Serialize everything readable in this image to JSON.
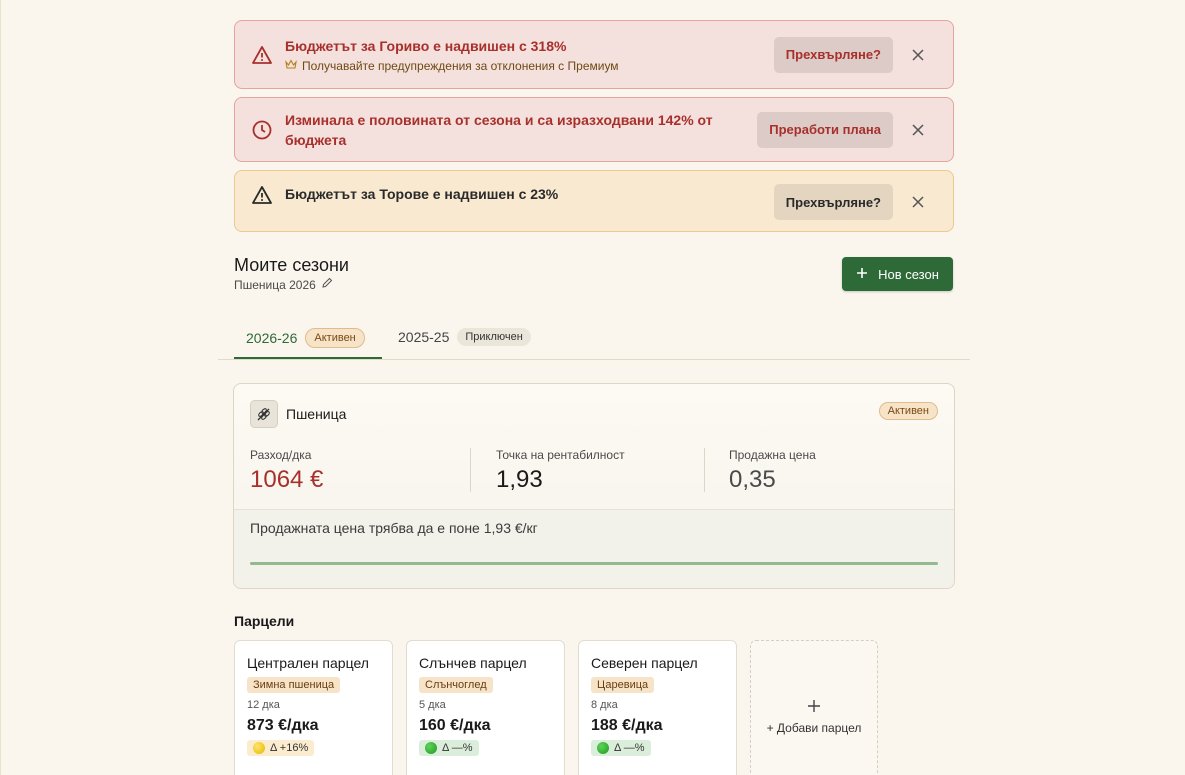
{
  "alerts": [
    {
      "title": "Бюджетът за Гориво е надвишен с 318%",
      "sub": "Получавайте предупреждения за отклонения с Премиум",
      "button": "Прехвърляне?"
    },
    {
      "title": "Изминала е половината от сезона и са изразходвани 142% от бюджета",
      "button": "Преработи плана"
    },
    {
      "title": "Бюджетът за Торове е надвишен с 23%",
      "button": "Прехвърляне?"
    }
  ],
  "seasons": {
    "title": "Моите сезони",
    "subtitle": "Пшеница 2026",
    "new_button": "Нов сезон"
  },
  "tabs": [
    {
      "label": "2026-26",
      "badge": "Активен"
    },
    {
      "label": "2025-25",
      "badge": "Приключен"
    }
  ],
  "crop": {
    "name": "Пшеница",
    "badge": "Активен",
    "metrics": [
      {
        "label": "Разход/дка",
        "value": "1064 €"
      },
      {
        "label": "Точка на рентабилност",
        "value": "1,93"
      },
      {
        "label": "Продажна цена",
        "value": "0,35"
      }
    ],
    "note": "Продажната цена трябва да е поне 1,93 €/кг"
  },
  "parcels": {
    "title": "Парцели",
    "items": [
      {
        "name": "Централен парцел",
        "crop": "Зимна пшеница",
        "area": "12 дка",
        "cost": "873 €/дка",
        "delta": "Δ +16%"
      },
      {
        "name": "Слънчев парцел",
        "crop": "Слънчоглед",
        "area": "5 дка",
        "cost": "160 €/дка",
        "delta": "Δ —%"
      },
      {
        "name": "Северен парцел",
        "crop": "Царевица",
        "area": "8 дка",
        "cost": "188 €/дка",
        "delta": "Δ —%"
      }
    ],
    "add_label": "+ Добави парцел"
  },
  "colors": {
    "accent": "#2e6a37",
    "danger": "#a8302c"
  }
}
